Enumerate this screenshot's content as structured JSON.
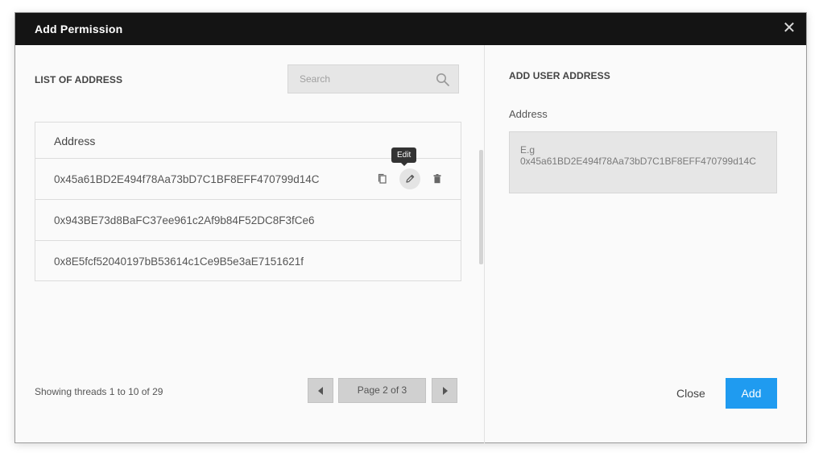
{
  "dialog": {
    "title": "Add Permission",
    "close_glyph": "✕"
  },
  "list_panel": {
    "title": "LIST OF ADDRESS",
    "search": {
      "placeholder": "Search",
      "icon": "search-icon"
    },
    "table": {
      "header": "Address",
      "rows": [
        {
          "address": "0x45a61BD2E494f78Aa73bD7C1BF8EFF470799d14C"
        },
        {
          "address": "0x943BE73d8BaFC37ee961c2Af9b84F52DC8F3fCe6"
        },
        {
          "address": "0x8E5fcf52040197bB53614c1Ce9B5e3aE7151621f"
        }
      ],
      "row_actions": [
        "copy-icon",
        "edit-icon",
        "trash-icon"
      ]
    },
    "tooltip": "Edit",
    "footer": {
      "showing": "Showing threads 1 to 10 of 29",
      "page_label": "Page 2 of 3"
    }
  },
  "add_panel": {
    "title": "ADD USER ADDRESS",
    "field_label": "Address",
    "placeholder": "E.g 0x45a61BD2E494f78Aa73bD7C1BF8EFF470799d14C",
    "close_label": "Close",
    "add_label": "Add"
  },
  "colors": {
    "header_bg": "#141414",
    "primary": "#1f9bf0",
    "panel_bg": "#fafafa"
  }
}
